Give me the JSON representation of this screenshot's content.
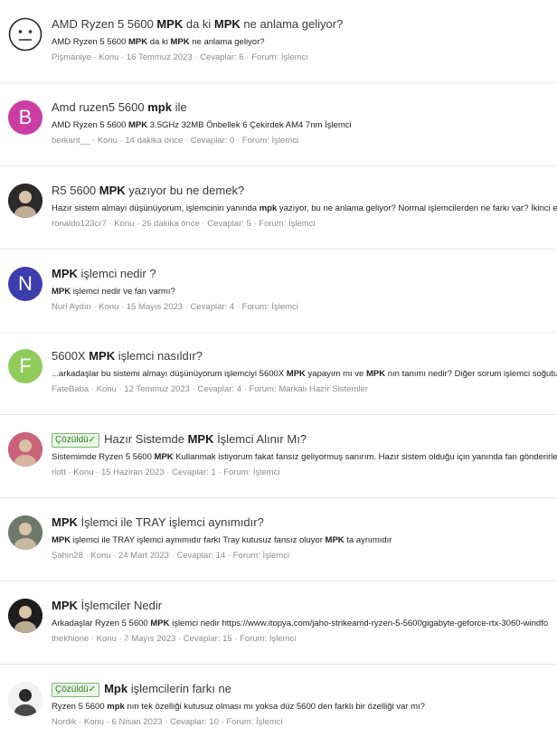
{
  "results": [
    {
      "title": [
        "AMD Ryzen 5 5600 ",
        "MPK",
        " da ki ",
        "MPK",
        " ne anlama geliyor?"
      ],
      "solved": false,
      "snippet": [
        "AMD Ryzen 5 5600 ",
        "MPK",
        " da ki ",
        "MPK",
        " ne anlama geliyor?"
      ],
      "author": "Pişmaniye",
      "type": "Konu",
      "date": "16 Temmuz 2023",
      "replies": "Cevaplar: 6",
      "forum": "İşlemci",
      "avatar": {
        "kind": "emoji",
        "icon": "neutral-face-icon",
        "color": "#ffffff"
      }
    },
    {
      "title": [
        "Amd ruzen5 5600 ",
        "mpk",
        " ile"
      ],
      "solved": false,
      "snippet": [
        "AMD Ryzen 5 5600 ",
        "MPK",
        " 3.5GHz 32MB Önbellek 6 Çekirdek AM4 7nm İşlemci"
      ],
      "author": "berkant__",
      "type": "Konu",
      "date": "14 dakika önce",
      "replies": "Cevaplar: 0",
      "forum": "İşlemci",
      "avatar": {
        "kind": "letter",
        "letter": "B",
        "color": "#cc3da3"
      }
    },
    {
      "title": [
        "R5 5600 ",
        "MPK",
        " yazıyor bu ne demek?"
      ],
      "solved": false,
      "snippet": [
        "Hazır sistem almayı düşünüyorum, işlemcinin yanında ",
        "mpk",
        " yazıyor, bu ne anlama geliyor? Normal işlemcilerden ne farkı var? İkinci el"
      ],
      "author": "ronaldo123cr7",
      "type": "Konu",
      "date": "26 dakika önce",
      "replies": "Cevaplar: 5",
      "forum": "İşlemci",
      "avatar": {
        "kind": "photo",
        "icon": "user-photo-icon",
        "color": "#2b2b2b"
      }
    },
    {
      "title": [
        "",
        "MPK",
        " işlemci nedir ?"
      ],
      "solved": false,
      "snippet": [
        "",
        "MPK",
        " işlemci nedir ve fan varmı?"
      ],
      "author": "Nuri Aydın",
      "type": "Konu",
      "date": "15 Mayıs 2023",
      "replies": "Cevaplar: 4",
      "forum": "İşlemci",
      "avatar": {
        "kind": "letter",
        "letter": "N",
        "color": "#3d3dae"
      }
    },
    {
      "title": [
        "5600X ",
        "MPK",
        " işlemci nasıldır?"
      ],
      "solved": false,
      "snippet": [
        "...arkadaşlar bu sistemi almayı düşünüyorum işlemciyi 5600X ",
        "MPK",
        " yapayım mı ve ",
        "MPK",
        " nın tanımı nedir? Diğer sorum işlemci soğutu"
      ],
      "author": "FateBaba",
      "type": "Konu",
      "date": "12 Temmuz 2023",
      "replies": "Cevaplar: 4",
      "forum": "Markalı Hazır Sistemler",
      "avatar": {
        "kind": "letter",
        "letter": "F",
        "color": "#8fcc5a"
      }
    },
    {
      "title": [
        "Hazır Sistemde ",
        "MPK",
        " İşlemci Alınır Mı?"
      ],
      "solved": true,
      "snippet": [
        "Sistemimde Ryzen 5 5600 ",
        "MPK",
        " Kullanmak istiyorum fakat fansız geliyormuş sanırım. Hazır sistem olduğu için yanında fan gönderirle"
      ],
      "author": "riott",
      "type": "Konu",
      "date": "15 Haziran 2023",
      "replies": "Cevaplar: 1",
      "forum": "İşlemci",
      "avatar": {
        "kind": "photo",
        "icon": "user-photo-icon",
        "color": "#c9637a"
      }
    },
    {
      "title": [
        "",
        "MPK",
        " İşlemci ile TRAY işlemci aynımıdır?"
      ],
      "solved": false,
      "snippet": [
        "",
        "MPK",
        " işlemci ile TRAY işlemci aynımıdır farkı Tray kutusuz fansız oluyor ",
        "MPK",
        " ta aynımıdır"
      ],
      "author": "Şahin28",
      "type": "Konu",
      "date": "24 Mart 2023",
      "replies": "Cevaplar: 14",
      "forum": "İşlemci",
      "avatar": {
        "kind": "photo",
        "icon": "user-photo-icon",
        "color": "#6d7a6a"
      }
    },
    {
      "title": [
        "",
        "MPK",
        " İşlemciler Nedir"
      ],
      "solved": false,
      "snippet": [
        "Arkadaşlar Ryzen 5 5600 ",
        "MPK",
        " işlemci nedir https://www.itopya.com/jaho-strikeamd-ryzen-5-5600gigabyte-geforce-rtx-3060-windfo"
      ],
      "author": "thekhione",
      "type": "Konu",
      "date": "7 Mayıs 2023",
      "replies": "Cevaplar: 15",
      "forum": "İşlemci",
      "avatar": {
        "kind": "photo",
        "icon": "user-photo-icon",
        "color": "#1e1e1e"
      }
    },
    {
      "title": [
        "",
        "Mpk",
        " işlemcilerin farkı ne"
      ],
      "solved": true,
      "snippet": [
        "Ryzen 5 5600 ",
        "mpk",
        " nın tek özelliği kutusuz olması mı yoksa düz 5600 den farklı bir özelliği var mı?"
      ],
      "author": "Nordik",
      "type": "Konu",
      "date": "6 Nisan 2023",
      "replies": "Cevaplar: 10",
      "forum": "İşlemci",
      "avatar": {
        "kind": "photo",
        "icon": "user-photo-icon",
        "color": "#f2f2f2"
      }
    }
  ],
  "solved_label": "Çözüldü✓",
  "meta_separator": " · "
}
